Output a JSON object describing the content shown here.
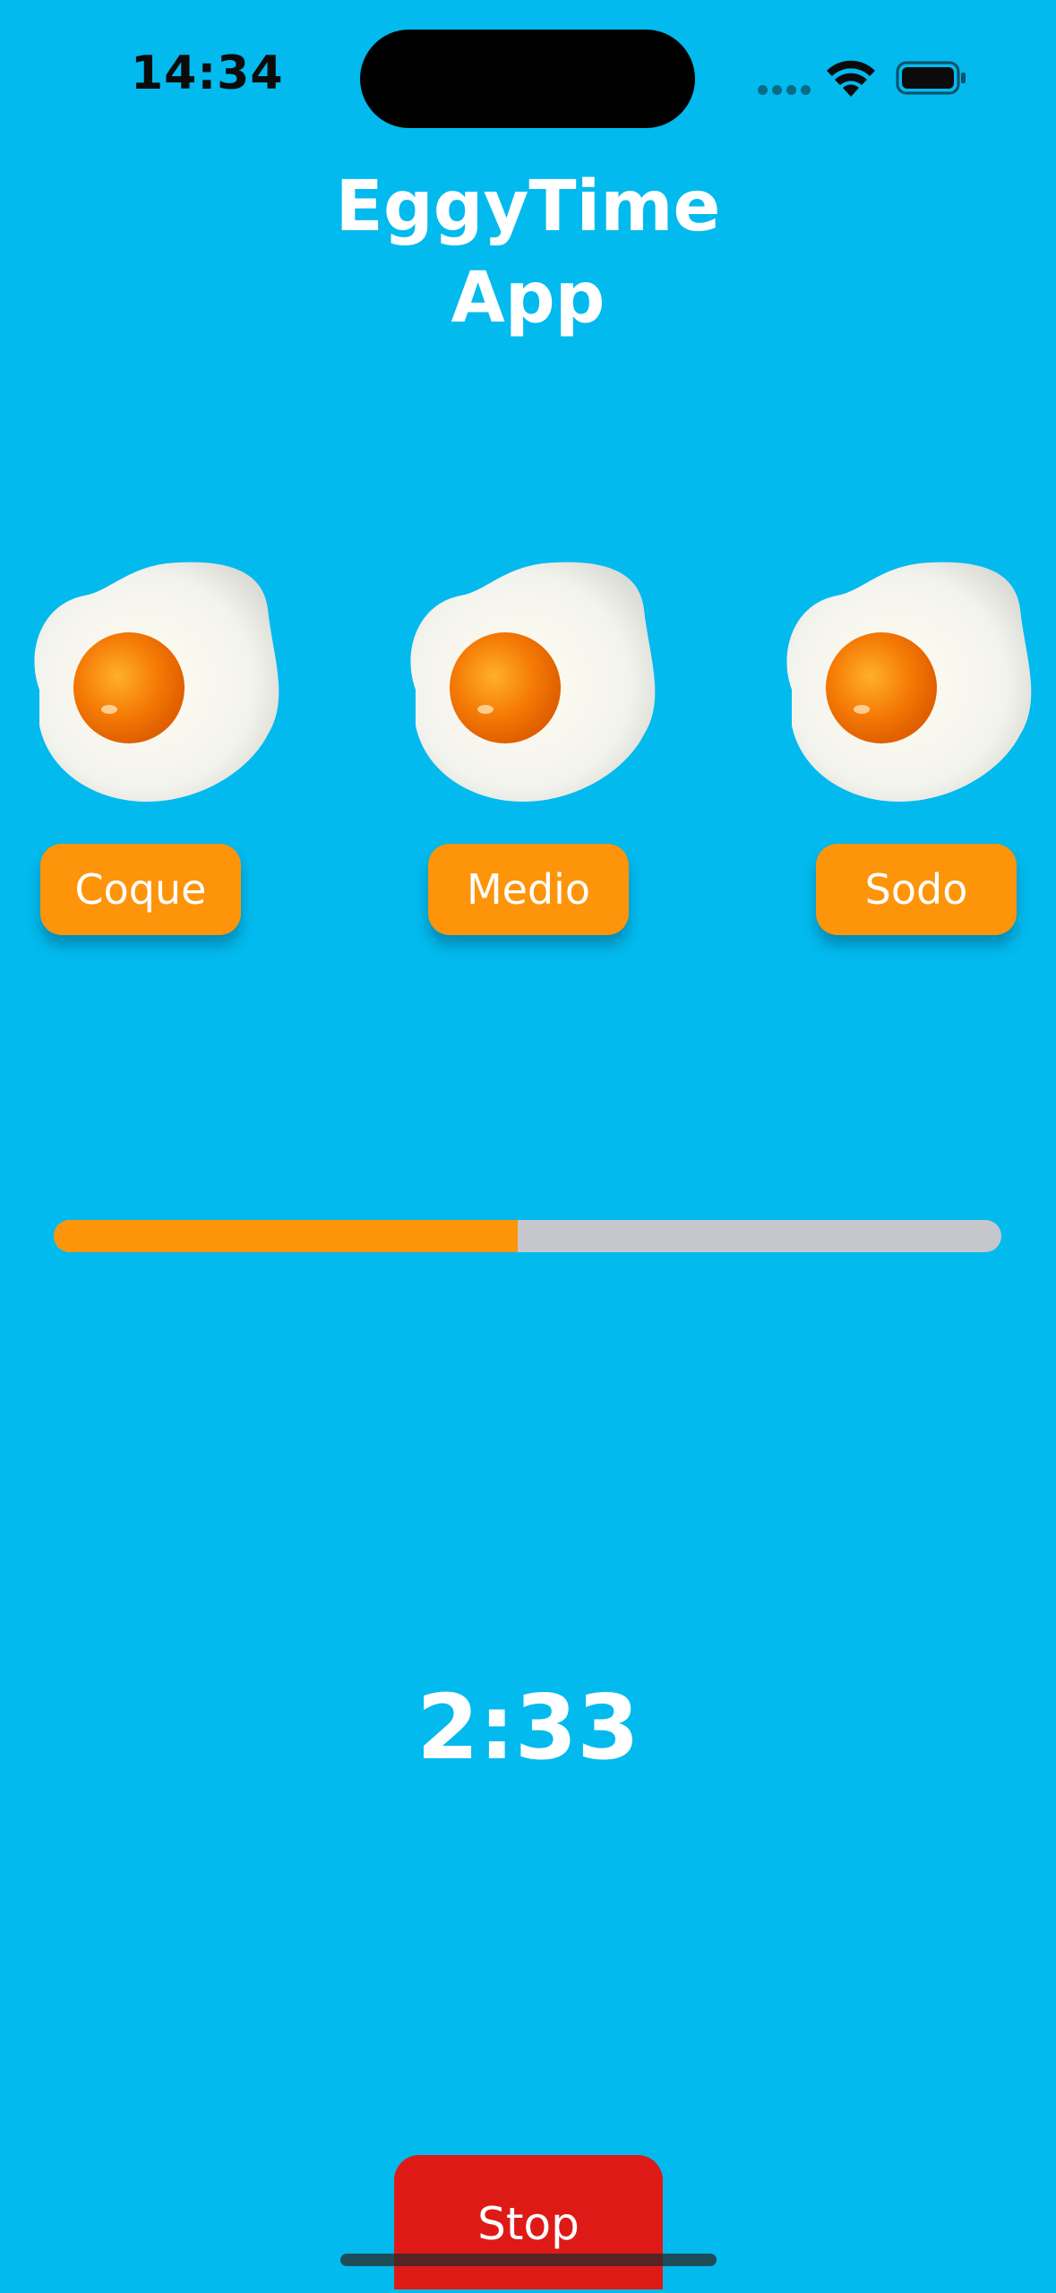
{
  "status_bar": {
    "time": "14:34",
    "icons": [
      "cell-signal-icon",
      "wifi-icon",
      "battery-icon"
    ]
  },
  "app": {
    "title": "EggyTime\nApp"
  },
  "eggs": [
    {
      "icon": "fried-egg-icon",
      "button_label": "Coque"
    },
    {
      "icon": "fried-egg-icon",
      "button_label": "Medio"
    },
    {
      "icon": "fried-egg-icon",
      "button_label": "Sodo"
    }
  ],
  "progress": {
    "fraction": 0.49
  },
  "timer": {
    "value": "2:33"
  },
  "stop_button": {
    "label": "Stop"
  },
  "colors": {
    "background": "#02BAEE",
    "accent": "#FD9409",
    "progress_track": "#C6C7CC",
    "stop": "#DE1A17",
    "text": "#FFFFFF"
  }
}
